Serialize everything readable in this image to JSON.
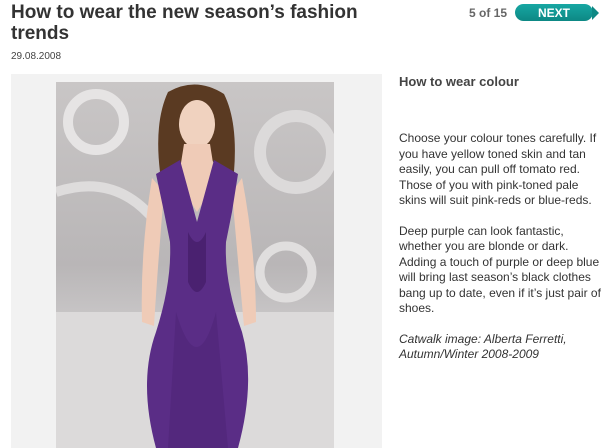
{
  "article": {
    "title": "How to wear the new season’s fashion trends",
    "date": "29.08.2008"
  },
  "pager": {
    "position": "5 of 15",
    "next_label": "NEXT"
  },
  "slide": {
    "heading": "How to wear colour",
    "paragraphs": [
      "Choose your colour tones carefully.  If you have yellow toned skin and tan easily, you can pull off tomato red. Those of you with pink-toned pale skins will suit pink-reds or blue-reds.",
      "Deep purple can look fantastic, whether you are blonde or dark. Adding a touch of purple or deep blue will bring last season’s black clothes bang up to date, even if it’s just pair of shoes."
    ],
    "caption": "Catwalk image: Alberta Ferretti, Autumn/Winter 2008-2009"
  },
  "colors": {
    "accent": "#0d8884",
    "dress": "#5a2d86"
  }
}
